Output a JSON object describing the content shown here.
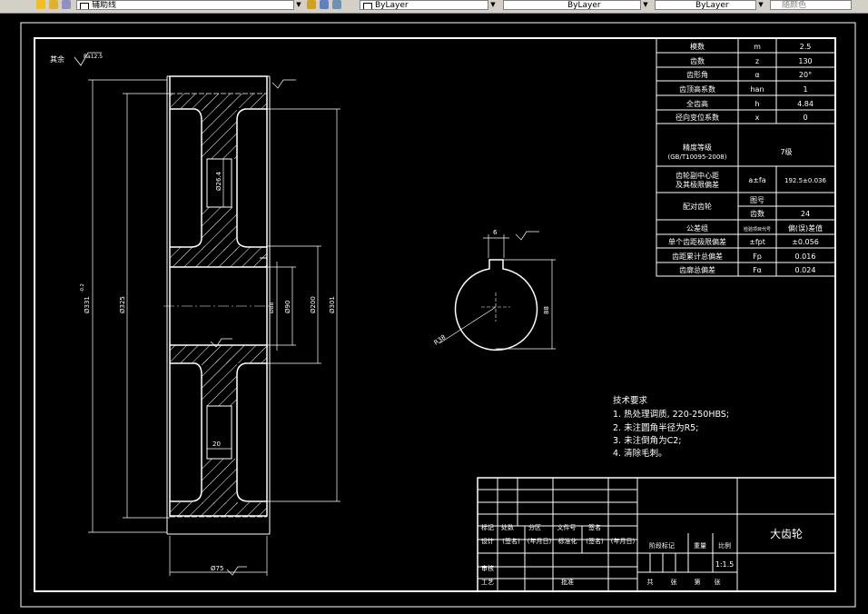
{
  "toolbar": {
    "layer_text": "辅助线",
    "linetype_text": "ByLayer",
    "lineweight_text": "ByLayer",
    "plotstyle_text": "ByLayer",
    "color_text": "随颜色"
  },
  "drawing": {
    "surface_note": "其余",
    "surface_note_ra": "Ra12.5",
    "dims": {
      "d_tip": "Ø331",
      "d_tip_tol": "-0.2",
      "d_325": "Ø325",
      "d_301": "Ø301",
      "d_200": "Ø200",
      "d_90": "Ø90",
      "d_88": "Ø88",
      "d_26": "Ø26.4",
      "d_20": "20",
      "d_75": "Ø75",
      "k_6": "6",
      "k_88": "88",
      "k_r": "R38"
    },
    "params": [
      {
        "name": "模数",
        "sym": "m",
        "val": "2.5"
      },
      {
        "name": "齿数",
        "sym": "z",
        "val": "130"
      },
      {
        "name": "齿形角",
        "sym": "α",
        "val": "20°"
      },
      {
        "name": "齿顶高系数",
        "sym": "han",
        "val": "1"
      },
      {
        "name": "全齿高",
        "sym": "h",
        "val": "4.84"
      },
      {
        "name": "径向变位系数",
        "sym": "x",
        "val": "0"
      }
    ],
    "precision": {
      "name": "精度等级",
      "standard": "(GB/T10095-2008)",
      "val": "7级"
    },
    "center": {
      "name1": "齿轮副中心距",
      "name2": "及其极限偏差",
      "sym": "a±fa",
      "val": "192.5±0.036"
    },
    "mate": {
      "name": "配对齿轮",
      "r1": "图号",
      "r2": "齿数",
      "r2v": "24"
    },
    "tolgroup": {
      "name": "公差组",
      "sym": "检验项目代号",
      "val": "偏(误)差值"
    },
    "tols": [
      {
        "name": "单个齿距极限偏差",
        "sym": "±fpt",
        "val": "±0.056"
      },
      {
        "name": "齿距累计总偏差",
        "sym": "Fp",
        "val": "0.016"
      },
      {
        "name": "齿廓总偏差",
        "sym": "Fα",
        "val": "0.024"
      }
    ],
    "tech": {
      "title": "技术要求",
      "lines": [
        "1. 热处理调质, 220-250HBS;",
        "2. 未注圆角半径为R5;",
        "3. 未注倒角为C2;",
        "4. 清除毛刺。"
      ]
    },
    "titleblock": {
      "part_name": "大齿轮",
      "h1": [
        "标记",
        "处数",
        "分区",
        "文件号",
        "签名"
      ],
      "h2": [
        "设计",
        "(签名)",
        "(年月日)",
        "标准化",
        "(签名)",
        "(年月日)"
      ],
      "stage": "阶段标记",
      "weight": "重量",
      "scale": "比例",
      "scale_val": "1:1.5",
      "review": "审核",
      "process": "工艺",
      "approve": "批准",
      "sheets": [
        "共",
        "张",
        "第",
        "张"
      ]
    }
  }
}
